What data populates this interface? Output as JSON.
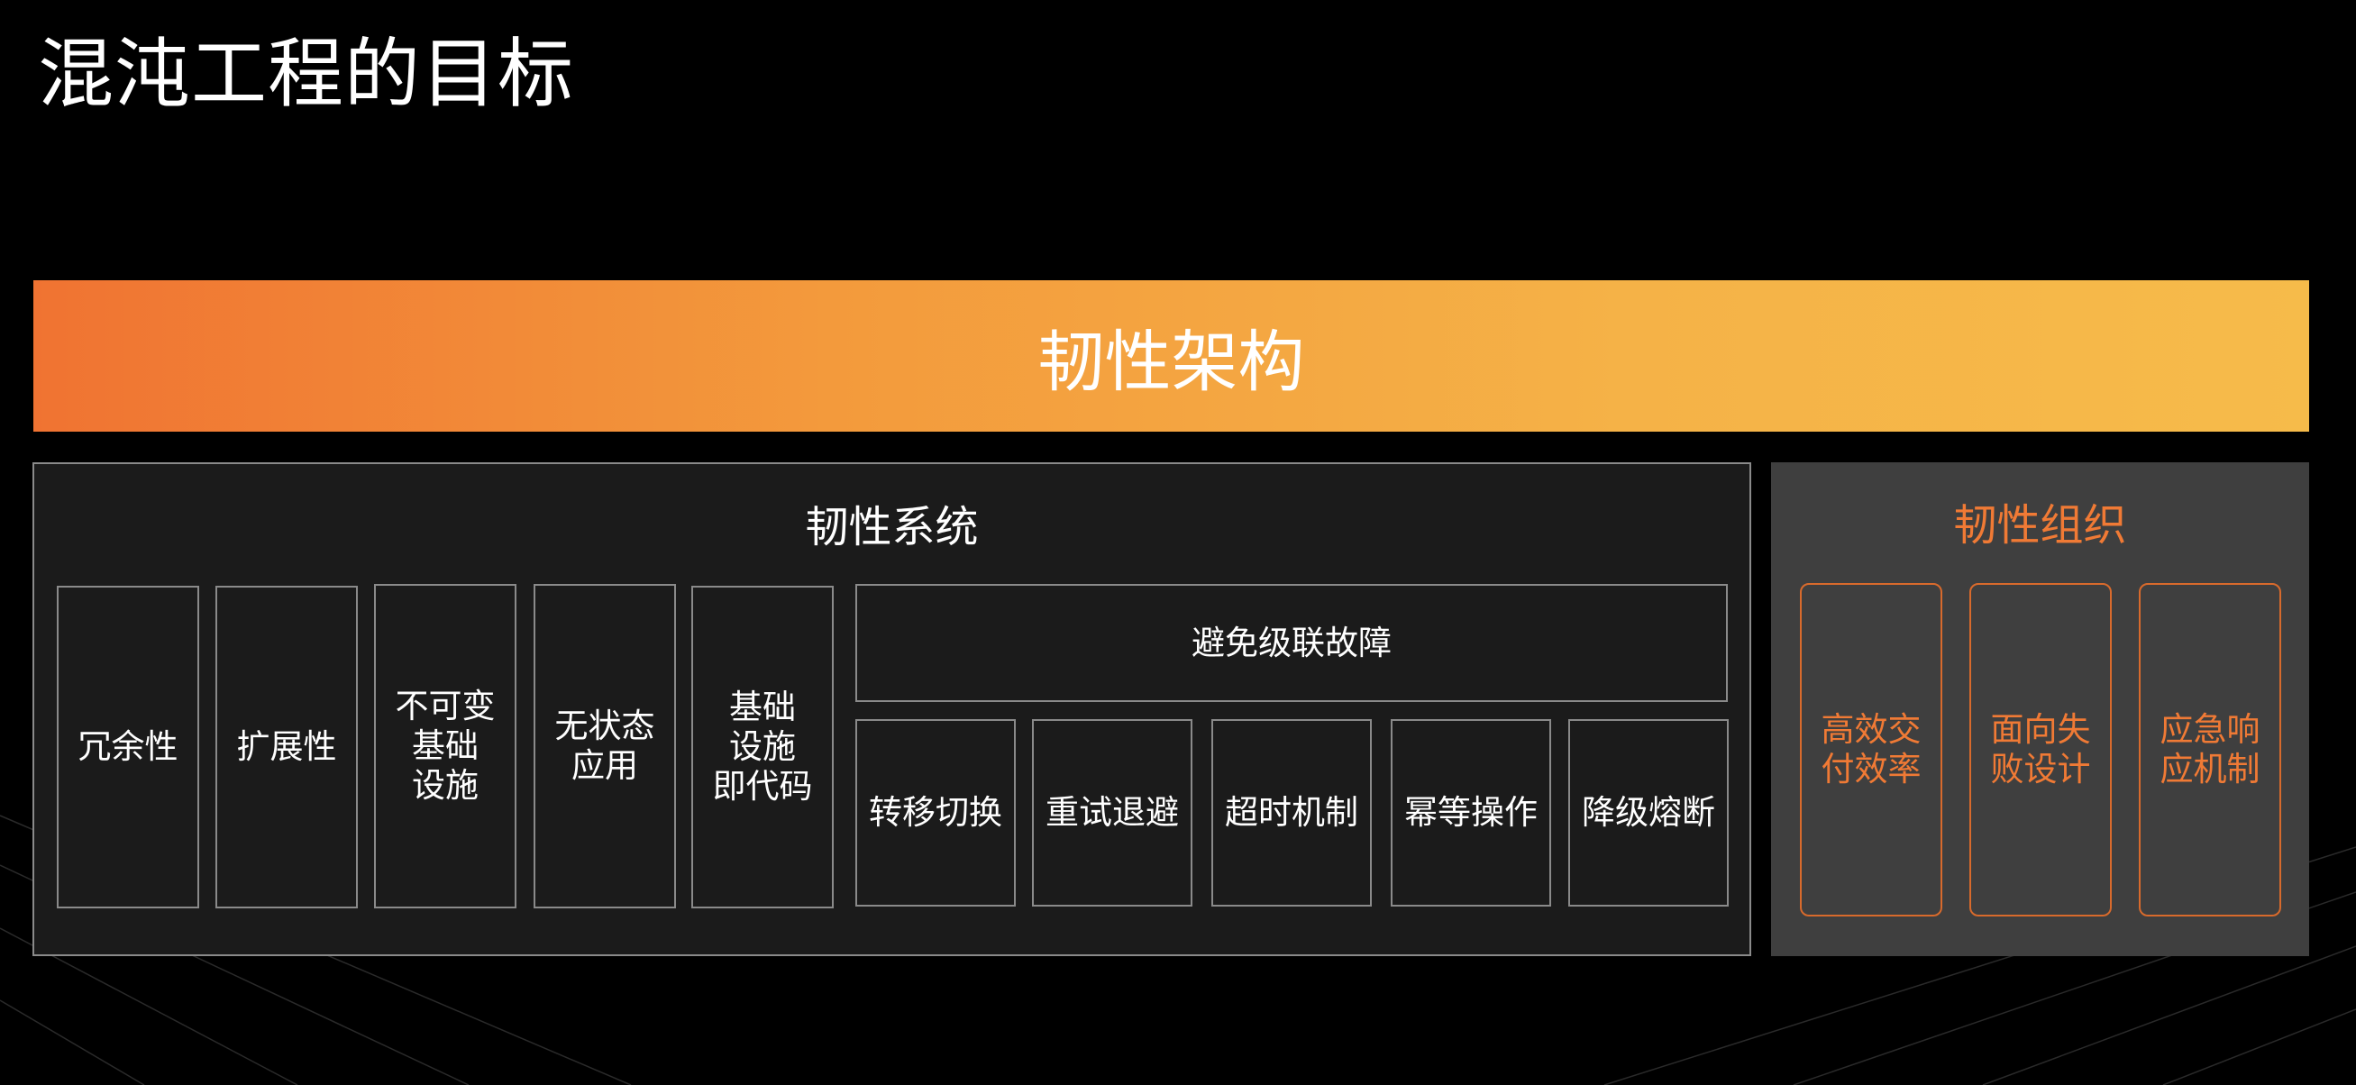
{
  "title": "混沌工程的目标",
  "top_banner": "韧性架构",
  "system": {
    "title": "韧性系统",
    "items": [
      "冗余性",
      "扩展性",
      "不可变\n基础\n设施",
      "无状态\n应用",
      "基础\n设施\n即代码"
    ],
    "cascade_title": "避免级联故障",
    "cascade_items": [
      "转移切换",
      "重试退避",
      "超时机制",
      "幂等操作",
      "降级熔断"
    ]
  },
  "organization": {
    "title": "韧性组织",
    "items": [
      "高效交\n付效率",
      "面向失\n败设计",
      "应急响\n应机制"
    ]
  },
  "colors": {
    "background": "#000000",
    "banner_start": "#f07332",
    "banner_end": "#f6bb4a",
    "accent": "#f07a35",
    "panel_dark": "#1b1b1b",
    "panel_gray": "#3f3f3f",
    "border": "#8a8a8a"
  }
}
